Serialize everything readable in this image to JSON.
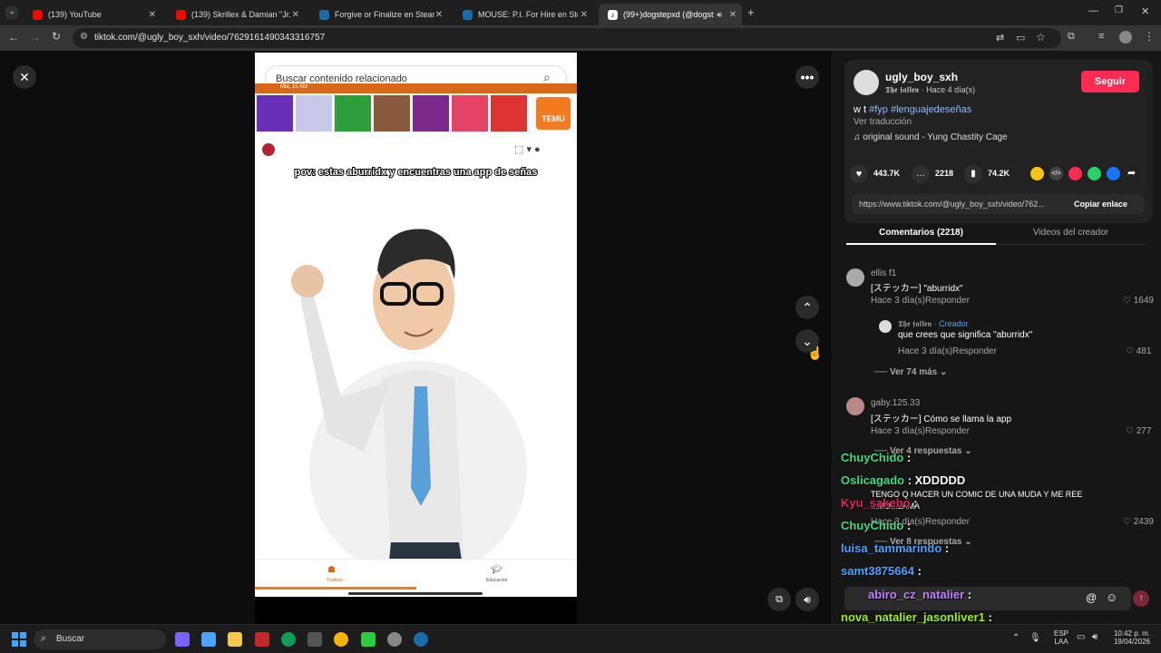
{
  "tabs": [
    {
      "label": "(139) YouTube",
      "color": "#ff0000"
    },
    {
      "label": "(139) Skrillex & Damian \"Jr. Gong\"",
      "color": "#ff0000"
    },
    {
      "label": "Forgive or Finalize en Steam",
      "color": "#1b6aa5"
    },
    {
      "label": "MOUSE: P.I. For Hire en Steam",
      "color": "#1b6aa5"
    },
    {
      "label": "(99+)dogstepxd (@dogstep",
      "color": "#ffffff"
    }
  ],
  "url": "tiktok.com/@ugly_boy_sxh/video/7629161490343316757",
  "video": {
    "search_placeholder": "Buscar contenido relacionado",
    "caption": "pov: estas aburridx y encuentras una app de señas",
    "date_text": "Mie, 15 Abr",
    "temu_label": "TEMU",
    "nav_left": "Traducir",
    "nav_right": "Educación"
  },
  "author": {
    "username": "ugly_boy_sxh",
    "display_line": "𝕿𝖍𝖊 𝖋𝖆𝖑𝖑𝖊𝖓 · Hace 4 día(s)",
    "follow": "Seguir",
    "desc_prefix": "w t ",
    "hashtags": "#fyp #lenguajedeseñas",
    "translate": "Ver traducción",
    "sound": "original sound - Yung Chastity Cage"
  },
  "stats": {
    "likes": "443.7K",
    "comments": "2218",
    "saves": "74.2K"
  },
  "share": {
    "link": "https://www.tiktok.com/@ugly_boy_sxh/video/762...",
    "copy": "Copiar enlace"
  },
  "panel_tabs": {
    "comments": "Comentarios (2218)",
    "creator": "Videos del creador"
  },
  "comments": [
    {
      "user": "ellis f1",
      "text": "[ステッカー] \"aburridx\"",
      "meta": "Hace 3 día(s)",
      "reply": "Responder",
      "likes": "1649"
    },
    {
      "user": "𝕿𝖍𝖊 𝖋𝖆𝖑𝖑𝖊𝖓",
      "badge": " · Creador",
      "text": "que crees que significa \"aburridx\"",
      "meta": "Hace 3 día(s)",
      "reply": "Responder",
      "likes": "481"
    },
    {
      "user": "gaby.125.33",
      "text": "[ステッカー] Cómo se llama la app",
      "meta": "Hace 3 día(s)",
      "reply": "Responder",
      "likes": "277"
    },
    {
      "user": "",
      "text": "TENGO Q HACER UN COMIC DE UNA MUDA Y ME REE",
      "text2": "...MO...LAMA",
      "meta": "Hace 3 día(s)",
      "reply": "Responder",
      "likes": "2439"
    }
  ],
  "more_replies": [
    "Ver 74 más",
    "Ver 4 respuestas",
    "Ver 8 respuestas"
  ],
  "chat_overlay": [
    {
      "user": "ChuyChido",
      "msg": "",
      "color": "#3ddc84"
    },
    {
      "user": "Oslicagado",
      "msg": "XDDDDD",
      "color": "#3ddc84"
    },
    {
      "user": "Kyu_sakebo",
      "msg": "",
      "color": "#e0245e"
    },
    {
      "user": "ChuyChido",
      "msg": "",
      "color": "#3ddc84"
    },
    {
      "user": "luisa_tammarindo",
      "msg": "",
      "color": "#4aa3ff"
    },
    {
      "user": "samt3875664",
      "msg": "",
      "color": "#4aa3ff"
    },
    {
      "user": "abiro_cz_natalier",
      "msg": "",
      "color": "#c080ff"
    },
    {
      "user": "nova_natalier_jasonliver1",
      "msg": "",
      "color": "#9ef01a"
    }
  ],
  "taskbar": {
    "search": "Buscar",
    "lang1": "ESP",
    "lang2": "LAA",
    "time": "10:42 p. m.",
    "date": "19/04/2026"
  }
}
